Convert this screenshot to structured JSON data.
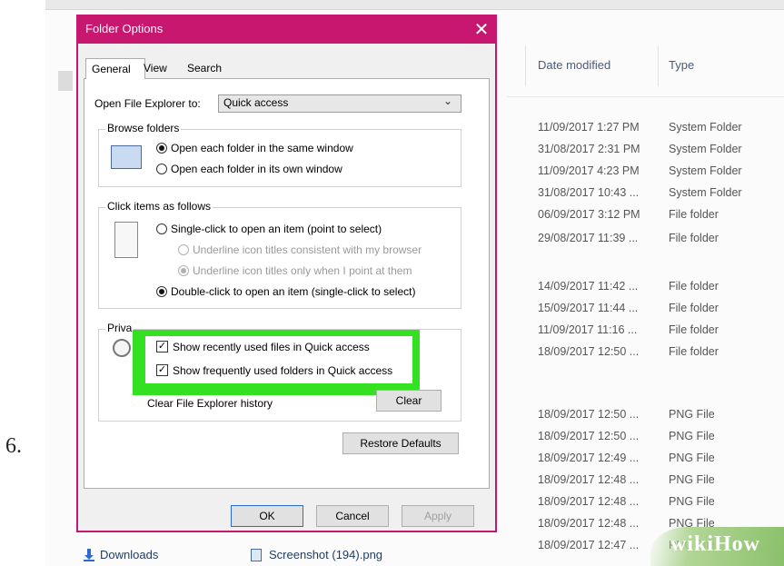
{
  "step_number": "6.",
  "explorer": {
    "columns": {
      "date_modified": "Date modified",
      "type": "Type"
    },
    "rows": [
      {
        "date": "11/09/2017 1:27 PM",
        "type": "System Folder"
      },
      {
        "date": "31/08/2017 2:31 PM",
        "type": "System Folder"
      },
      {
        "date": "11/09/2017 4:23 PM",
        "type": "System Folder"
      },
      {
        "date": "31/08/2017 10:43 ...",
        "type": "System Folder"
      },
      {
        "date": "06/09/2017 3:12 PM",
        "type": "File folder"
      },
      {
        "date": "29/08/2017 11:39 ...",
        "type": "File folder"
      },
      {
        "date": "14/09/2017 11:42 ...",
        "type": "File folder"
      },
      {
        "date": "15/09/2017 11:44 ...",
        "type": "File folder"
      },
      {
        "date": "11/09/2017 11:16 ...",
        "type": "File folder"
      },
      {
        "date": "18/09/2017 12:50 ...",
        "type": "File folder"
      },
      {
        "date": "18/09/2017 12:50 ...",
        "type": "PNG File"
      },
      {
        "date": "18/09/2017 12:50 ...",
        "type": "PNG File"
      },
      {
        "date": "18/09/2017 12:49 ...",
        "type": "PNG File"
      },
      {
        "date": "18/09/2017 12:48 ...",
        "type": "PNG File"
      },
      {
        "date": "18/09/2017 12:48 ...",
        "type": "PNG File"
      },
      {
        "date": "18/09/2017 12:48 ...",
        "type": "PNG File"
      },
      {
        "date": "18/09/2017 12:47 ...",
        "type": "PNG File"
      }
    ],
    "nav_downloads": "Downloads",
    "file_name": "Screenshot (194).png"
  },
  "dialog": {
    "title": "Folder Options",
    "close_symbol": "✕",
    "tabs": [
      "General",
      "View",
      "Search"
    ],
    "open_explorer_to_label": "Open File Explorer to:",
    "open_explorer_to_value": "Quick access",
    "browse_folders": {
      "legend": "Browse folders",
      "same_window": "Open each folder in the same window",
      "own_window": "Open each folder in its own window"
    },
    "click_items": {
      "legend": "Click items as follows",
      "single_click": "Single-click to open an item (point to select)",
      "underline_browser": "Underline icon titles consistent with my browser",
      "underline_point": "Underline icon titles only when I point at them",
      "double_click": "Double-click to open an item (single-click to select)"
    },
    "privacy": {
      "legend": "Priva",
      "recent_files": "Show recently used files in Quick access",
      "frequent_folders": "Show frequently used folders in Quick access",
      "clear_history_label": "Clear File Explorer history",
      "clear_button": "Clear"
    },
    "restore_defaults": "Restore Defaults",
    "ok": "OK",
    "cancel": "Cancel",
    "apply": "Apply"
  },
  "watermark": {
    "wiki": "wiki",
    "how": "How"
  },
  "colors": {
    "titlebar": "#c8176e",
    "highlight": "#34e022"
  }
}
